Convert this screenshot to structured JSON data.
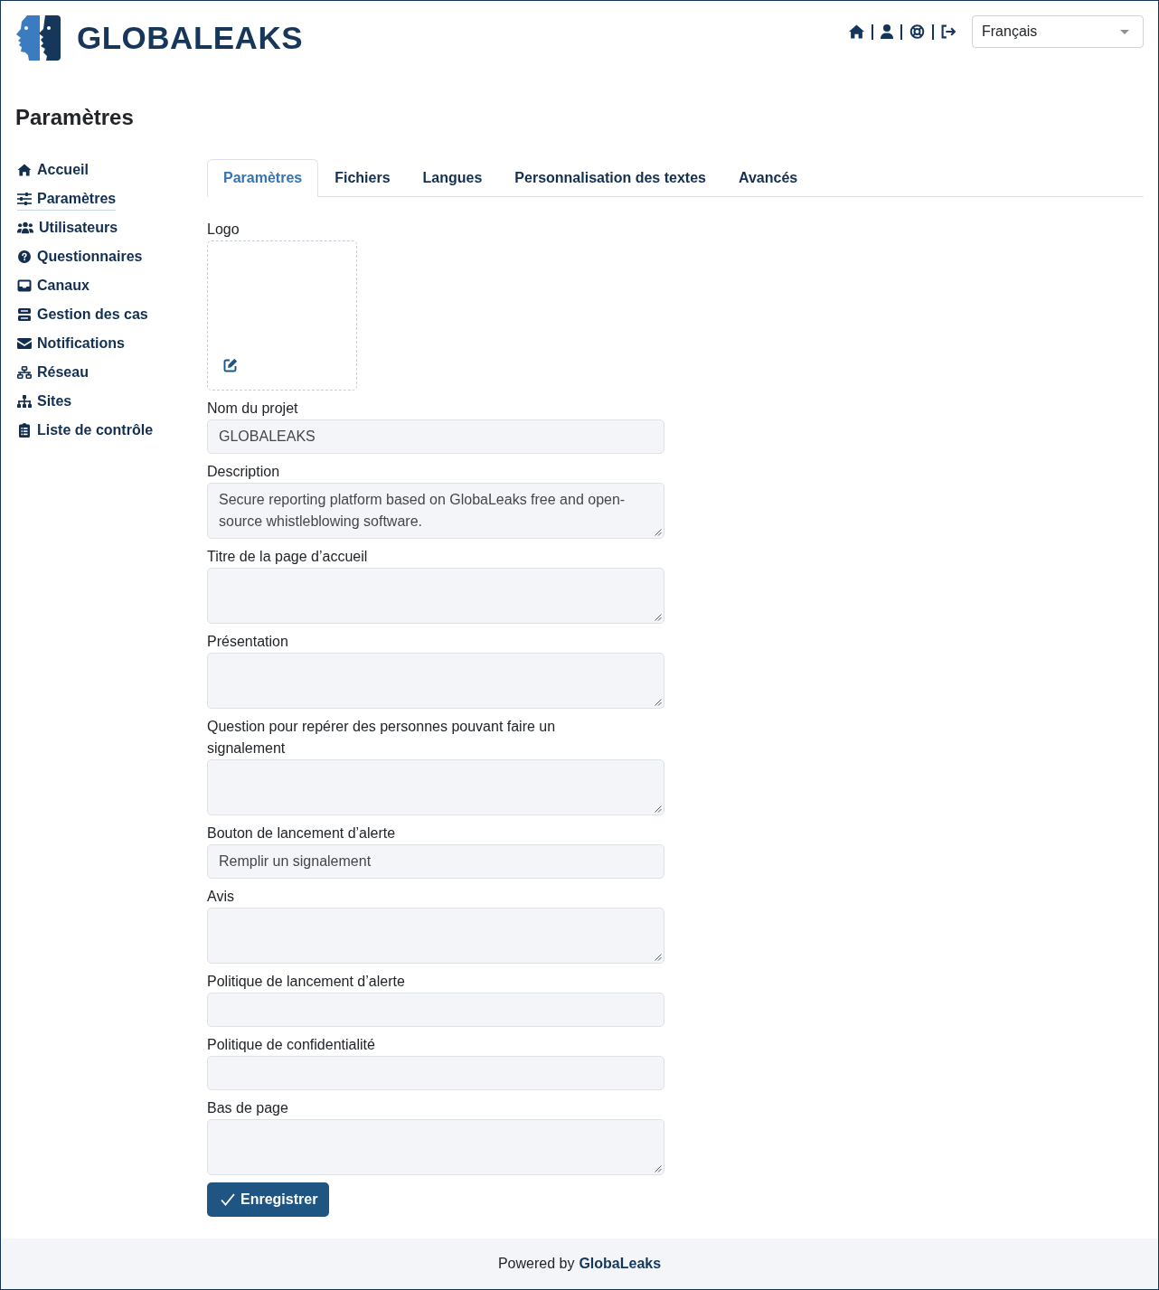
{
  "header": {
    "logo_text": "GLOBALEAKS",
    "language_select": {
      "value": "Français"
    }
  },
  "page_title": "Paramètres",
  "sidebar": {
    "items": [
      {
        "label": "Accueil",
        "selected": false
      },
      {
        "label": "Paramètres",
        "selected": true
      },
      {
        "label": "Utilisateurs",
        "selected": false
      },
      {
        "label": "Questionnaires",
        "selected": false
      },
      {
        "label": "Canaux",
        "selected": false
      },
      {
        "label": "Gestion des cas",
        "selected": false
      },
      {
        "label": "Notifications",
        "selected": false
      },
      {
        "label": "Réseau",
        "selected": false
      },
      {
        "label": "Sites",
        "selected": false
      },
      {
        "label": "Liste de contrôle",
        "selected": false
      }
    ]
  },
  "tabs": [
    {
      "label": "Paramètres",
      "selected": true
    },
    {
      "label": "Fichiers",
      "selected": false
    },
    {
      "label": "Langues",
      "selected": false
    },
    {
      "label": "Personnalisation des textes",
      "selected": false
    },
    {
      "label": "Avancés",
      "selected": false
    }
  ],
  "form": {
    "logo": {
      "label": "Logo"
    },
    "fields": [
      {
        "label": "Nom du projet",
        "kind": "input",
        "value": "GLOBALEAKS"
      },
      {
        "label": "Description",
        "kind": "textarea",
        "value": "Secure reporting platform based on GlobaLeaks free and open-source whistleblowing software."
      },
      {
        "label": "Titre de la page d’accueil",
        "kind": "textarea"
      },
      {
        "label": "Présentation",
        "kind": "textarea"
      },
      {
        "label": "Question pour repérer des personnes pouvant faire un signalement",
        "kind": "textarea"
      },
      {
        "label": "Bouton de lancement d’alerte",
        "kind": "input",
        "value": "Remplir un signalement"
      },
      {
        "label": "Avis",
        "kind": "textarea"
      },
      {
        "label": "Politique de lancement d’alerte",
        "kind": "input"
      },
      {
        "label": "Politique de confidentialité",
        "kind": "input"
      },
      {
        "label": "Bas de page",
        "kind": "textarea"
      }
    ],
    "save_button": {
      "label": "Enregistrer"
    }
  },
  "footer": {
    "text": "Powered by",
    "link": "GlobaLeaks"
  }
}
